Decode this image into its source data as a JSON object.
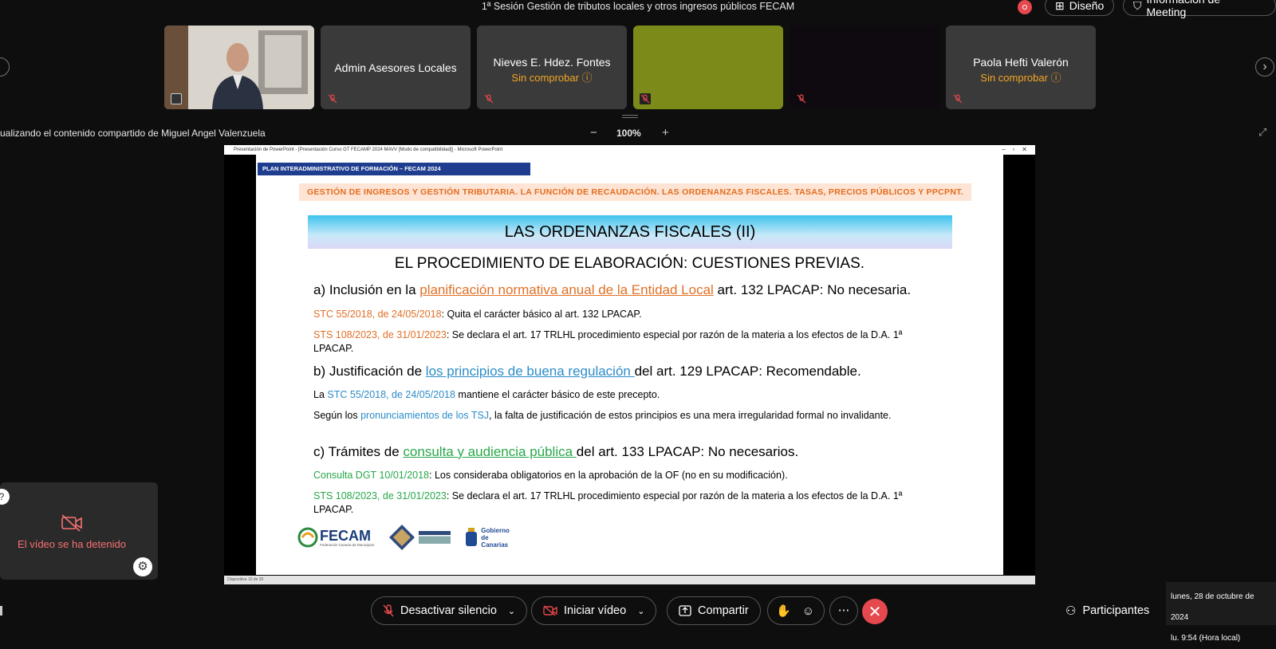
{
  "meeting": {
    "title": "1ª Sesión Gestión de tributos locales y otros ingresos públicos FECAM",
    "layout_label": "Diseño",
    "info_label": "Información de Meeting"
  },
  "participants_strip": [
    {
      "name": "",
      "status": "",
      "type": "video"
    },
    {
      "name": "Admin Asesores Locales",
      "status": ""
    },
    {
      "name": "Nieves E. Hdez. Fontes",
      "status": "Sin comprobar"
    },
    {
      "name": "",
      "status": "",
      "type": "green"
    },
    {
      "name": "",
      "status": "",
      "type": "black"
    },
    {
      "name": "Paola Hefti Valerón",
      "status": "Sin comprobar"
    }
  ],
  "share_bar": {
    "viewing_text": "ualizando el contenido compartido de Miguel Angel Valenzuela",
    "zoom": "100%",
    "zoom_out": "−",
    "zoom_in": "+"
  },
  "ppt": {
    "window_title": "Presentación de PowerPoint - [Presentación Curso GT FECAMP 2024 MAVV [Modo de compatibilidad]] - Microsoft PowerPoint",
    "status": "Diapositiva 10 de 33",
    "header": "PLAN INTERADMINISTRATIVO DE FORMACIÓN – FECAM 2024",
    "orange_banner": "GESTIÓN DE INGRESOS Y GESTIÓN TRIBUTARIA. LA FUNCIÓN DE RECAUDACIÓN. LAS ORDENANZAS FISCALES. TASAS, PRECIOS PÚBLICOS Y PPCPNT.",
    "band_title": "LAS ORDENANZAS FISCALES (II)",
    "subtitle": "EL PROCEDIMIENTO DE ELABORACIÓN: CUESTIONES PREVIAS.",
    "a_pre": "a) Inclusión en la ",
    "a_link": "planificación normativa anual de la Entidad Local",
    "a_post": " art. 132 LPACAP: No necesaria.",
    "a1_ref": "STC 55/2018, de 24/05/2018",
    "a1_text": ": Quita el carácter básico al art. 132 LPACAP.",
    "a2_ref": "STS 108/2023, de 31/01/2023",
    "a2_text": ": Se declara el art. 17 TRLHL procedimiento especial por razón de la materia a los efectos de la D.A. 1ª LPACAP.",
    "b_pre": "b) Justificación de ",
    "b_link": "los principios de buena regulación ",
    "b_post": "del art. 129 LPACAP: Recomendable.",
    "b1_pre": "La ",
    "b1_ref": "STC 55/2018, de 24/05/2018",
    "b1_text": " mantiene el carácter básico de este precepto.",
    "b2_pre": "Según los ",
    "b2_ref": "pronunciamientos de los TSJ",
    "b2_text": ", la falta de justificación de estos principios es una mera irregularidad formal no invalidante.",
    "c_pre": "c) Trámites de ",
    "c_link": "consulta y audiencia pública ",
    "c_post": "del art. 133 LPACAP: No necesarios.",
    "c1_ref": "Consulta DGT 10/01/2018",
    "c1_text": ": Los consideraba obligatorios en la aprobación de la OF (no en su modificación).",
    "c2_ref": "STS 108/2023, de 31/01/2023",
    "c2_text": ": Se declara el art. 17 TRLHL procedimiento especial por razón de la materia a los efectos de la D.A. 1ª LPACAP.",
    "logo_fecam": "FECAM",
    "logo_fecam_sub": "Federación Canaria de Municipios",
    "logo_gob": "Gobierno de Canarias"
  },
  "self_view": {
    "message": "El vídeo se ha detenido"
  },
  "controls": {
    "mute": "Desactivar silencio",
    "video": "Iniciar vídeo",
    "share": "Compartir",
    "participants": "Participantes"
  },
  "clock": {
    "date": "lunes, 28 de octubre de 2024",
    "time": "lu. 9:54 (Hora local)"
  },
  "colors": {
    "accent_red": "#e5484d",
    "orange": "#e07026",
    "blue": "#2c8cc9",
    "green": "#27a84a"
  }
}
